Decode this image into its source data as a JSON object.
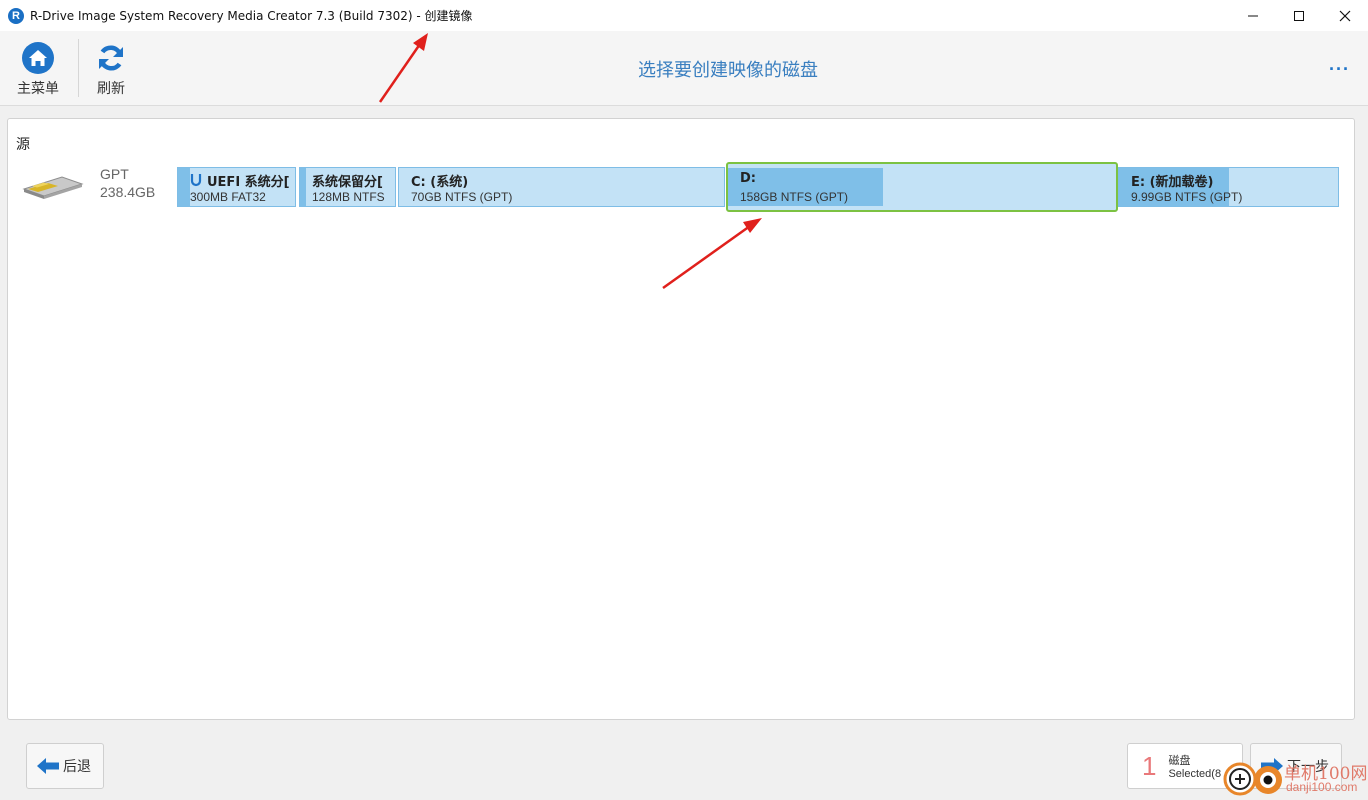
{
  "window": {
    "app_icon_letter": "R",
    "title": "R-Drive Image System Recovery Media Creator 7.3 (Build 7302) - 创建镜像"
  },
  "toolbar": {
    "main_menu_label": "主菜单",
    "refresh_label": "刷新",
    "page_title": "选择要创建映像的磁盘",
    "more_label": "···"
  },
  "source": {
    "label": "源",
    "disk": {
      "type": "GPT",
      "size": "238.4GB"
    },
    "partitions": [
      {
        "name": "UEFI 系统分[",
        "info": "300MB FAT32",
        "used_fraction": 0.1,
        "selected": false,
        "has_badge": true
      },
      {
        "name": "系统保留分[",
        "info": "128MB NTFS",
        "used_fraction": 0.06,
        "selected": false,
        "has_badge": false
      },
      {
        "name": "C: (系统)",
        "info": "70GB NTFS (GPT)",
        "used_fraction": 0.0,
        "selected": false,
        "has_badge": false
      },
      {
        "name": "D:",
        "info": "158GB NTFS (GPT)",
        "used_fraction": 0.4,
        "selected": true,
        "has_badge": false
      },
      {
        "name": "E: (新加载卷)",
        "info": "9.99GB NTFS (GPT)",
        "used_fraction": 0.5,
        "selected": false,
        "has_badge": false
      }
    ]
  },
  "footer": {
    "back_label": "后退",
    "selected_count": "1",
    "selected_type": "磁盘",
    "selected_text": "Selected(8",
    "next_label": "下一步"
  },
  "watermark": {
    "line1": "单机100网",
    "line2": "danji100.com"
  },
  "colors": {
    "accent": "#1f74c8",
    "partition_fill": "#c3e2f6",
    "partition_used": "#7fbfe8",
    "selection_border": "#7cc242",
    "annotation_arrow": "#e0201c"
  }
}
